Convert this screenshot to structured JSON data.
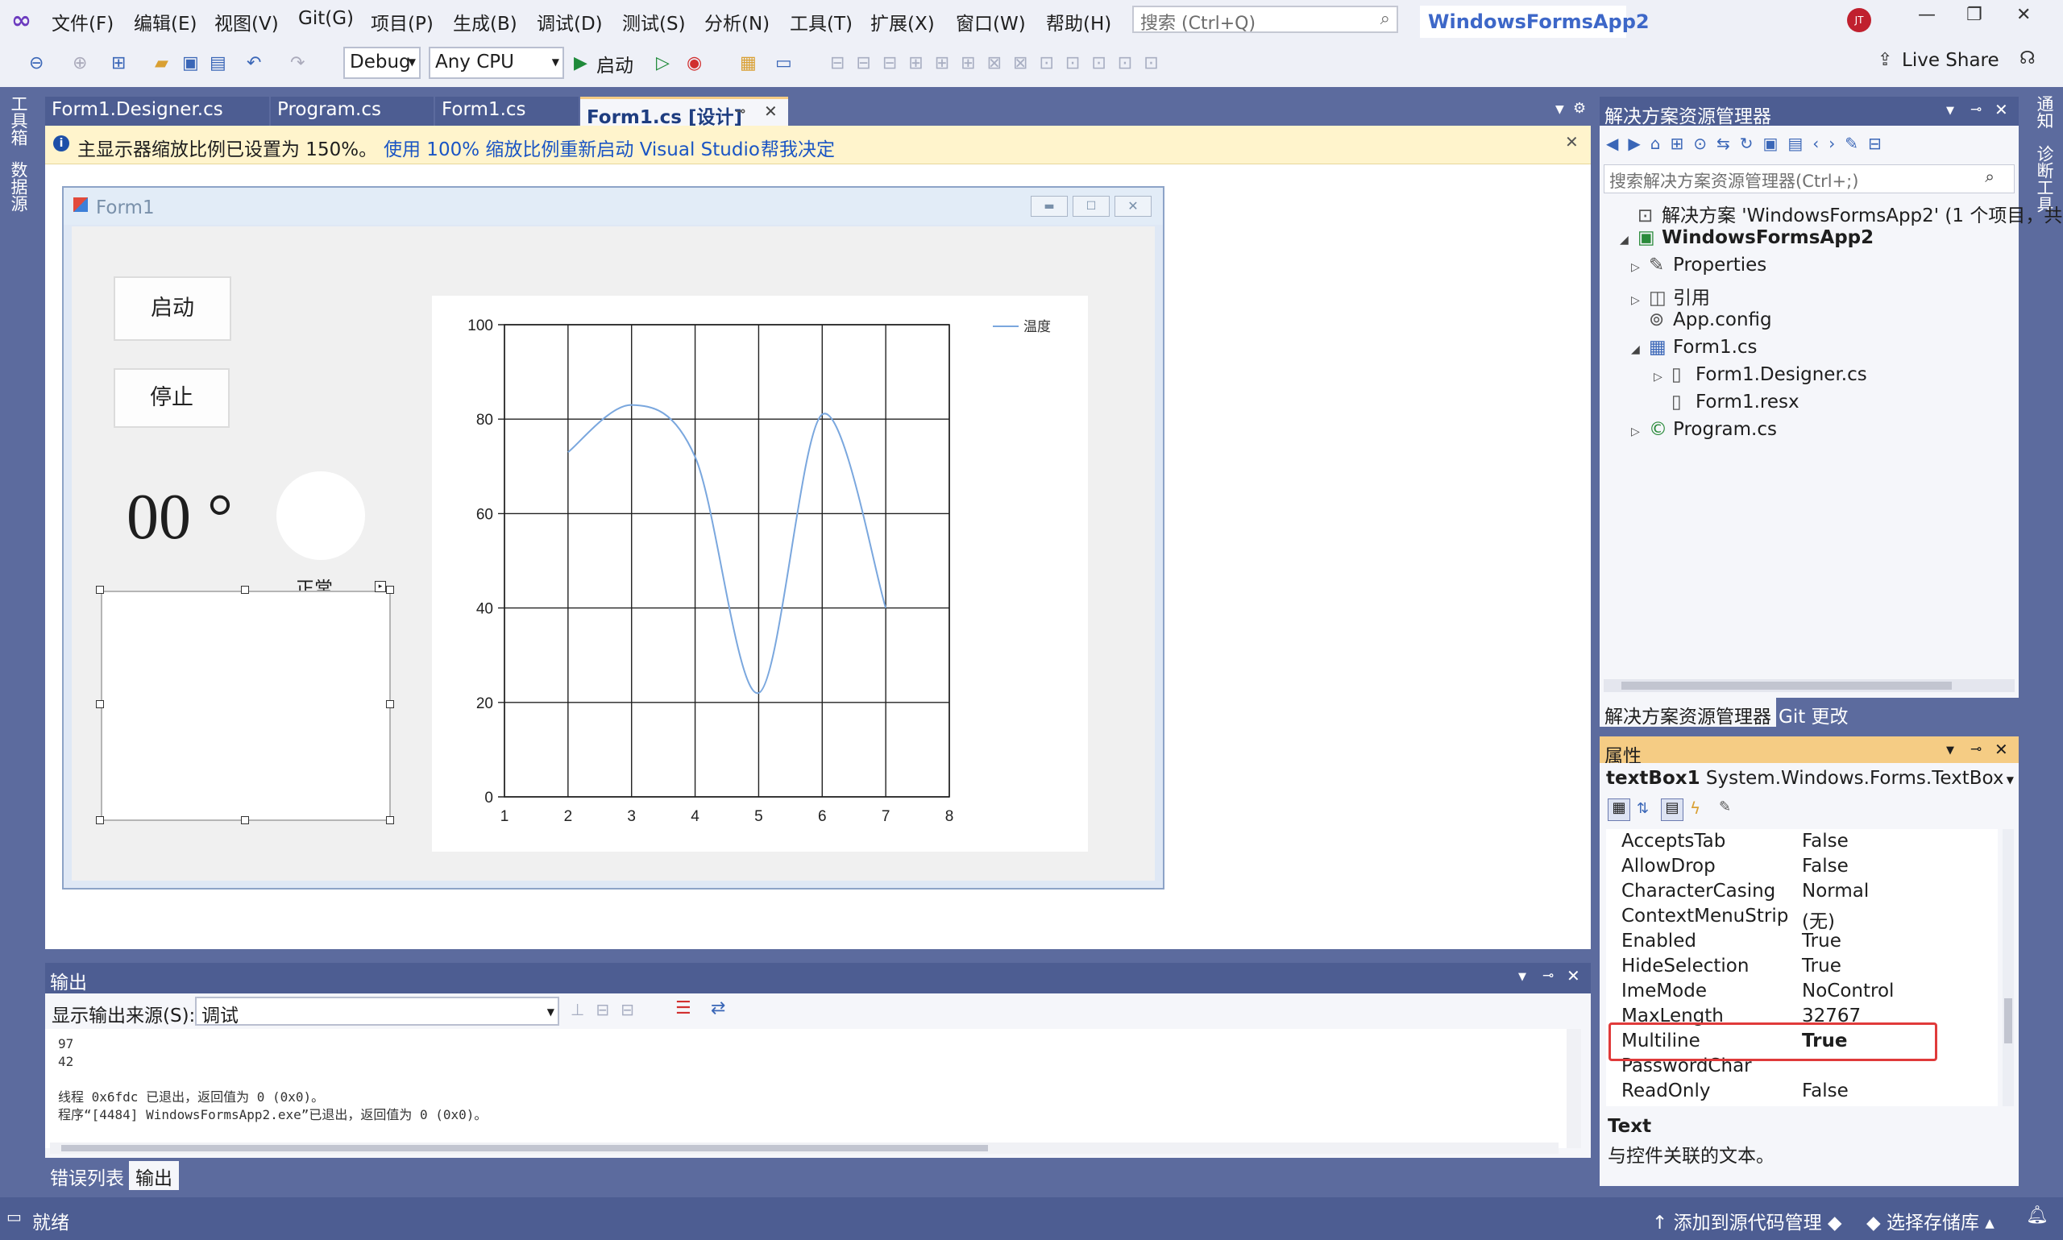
{
  "menu": [
    "文件(F)",
    "编辑(E)",
    "视图(V)",
    "Git(G)",
    "项目(P)",
    "生成(B)",
    "调试(D)",
    "测试(S)",
    "分析(N)",
    "工具(T)",
    "扩展(X)",
    "窗口(W)",
    "帮助(H)"
  ],
  "search": {
    "placeholder": "搜索 (Ctrl+Q)"
  },
  "app_title": "WindowsFormsApp2",
  "user_initials": "JT",
  "live_share": "Live Share",
  "toolbar": {
    "config": "Debug",
    "platform": "Any CPU",
    "start": "启动"
  },
  "side_tabs_left": [
    "工具箱",
    "数据源"
  ],
  "side_tabs_right": [
    "通知",
    "诊断工具"
  ],
  "doc_tabs": [
    "Form1.Designer.cs",
    "Program.cs",
    "Form1.cs",
    "Form1.cs [设计]"
  ],
  "infobar": {
    "message": "主显示器缩放比例已设置为 150%。",
    "action1": "使用 100% 缩放比例重新启动 Visual Studio",
    "action2": "帮我决定"
  },
  "form": {
    "title": "Form1",
    "start_button": "启动",
    "stop_button": "停止",
    "temperature": "00 °",
    "status": "正常"
  },
  "chart_data": {
    "type": "line",
    "legend_position": "top-right",
    "grid": true,
    "xlim": [
      1,
      8
    ],
    "ylim": [
      0,
      100
    ],
    "x_ticks": [
      1,
      2,
      3,
      4,
      5,
      6,
      7,
      8
    ],
    "y_ticks": [
      0,
      20,
      40,
      60,
      80,
      100
    ],
    "series": [
      {
        "name": "温度",
        "color": "#7aa7de",
        "x": [
          2,
          3,
          4,
          5,
          6,
          7
        ],
        "y": [
          73,
          83,
          72,
          22,
          81,
          40
        ]
      }
    ]
  },
  "solution_explorer": {
    "title": "解决方案资源管理器",
    "search_placeholder": "搜索解决方案资源管理器(Ctrl+;)",
    "items": [
      {
        "label": "解决方案 'WindowsFormsApp2' (1 个项目，共",
        "level": 0,
        "exp": ""
      },
      {
        "label": "WindowsFormsApp2",
        "level": 1,
        "exp": "◢",
        "bold": true
      },
      {
        "label": "Properties",
        "level": 2,
        "exp": "▷"
      },
      {
        "label": "引用",
        "level": 2,
        "exp": "▷"
      },
      {
        "label": "App.config",
        "level": 2,
        "exp": ""
      },
      {
        "label": "Form1.cs",
        "level": 2,
        "exp": "◢"
      },
      {
        "label": "Form1.Designer.cs",
        "level": 3,
        "exp": "▷"
      },
      {
        "label": "Form1.resx",
        "level": 3,
        "exp": ""
      },
      {
        "label": "Program.cs",
        "level": 2,
        "exp": "▷"
      }
    ],
    "bottom_tabs": [
      "解决方案资源管理器",
      "Git 更改"
    ]
  },
  "properties": {
    "title": "属性",
    "object": "textBox1",
    "object_type": "System.Windows.Forms.TextBox",
    "rows": [
      {
        "name": "AcceptsTab",
        "value": "False"
      },
      {
        "name": "AllowDrop",
        "value": "False"
      },
      {
        "name": "CharacterCasing",
        "value": "Normal"
      },
      {
        "name": "ContextMenuStrip",
        "value": "(无)"
      },
      {
        "name": "Enabled",
        "value": "True"
      },
      {
        "name": "HideSelection",
        "value": "True"
      },
      {
        "name": "ImeMode",
        "value": "NoControl"
      },
      {
        "name": "MaxLength",
        "value": "32767"
      },
      {
        "name": "Multiline",
        "value": "True",
        "highlight": true
      },
      {
        "name": "PasswordChar",
        "value": ""
      },
      {
        "name": "ReadOnly",
        "value": "False"
      }
    ],
    "desc_title": "Text",
    "desc_text": "与控件关联的文本。"
  },
  "output": {
    "title": "输出",
    "source_label": "显示输出来源(S):",
    "source_value": "调试",
    "lines": [
      "97",
      "42",
      "",
      "线程 0x6fdc 已退出，返回值为 0 (0x0)。",
      "程序“[4484] WindowsFormsApp2.exe”已退出，返回值为 0 (0x0)。"
    ],
    "tabs": [
      "错误列表",
      "输出"
    ]
  },
  "status": {
    "text": "就绪",
    "add_source": "添加到源代码管理",
    "select_repo": "选择存储库"
  }
}
